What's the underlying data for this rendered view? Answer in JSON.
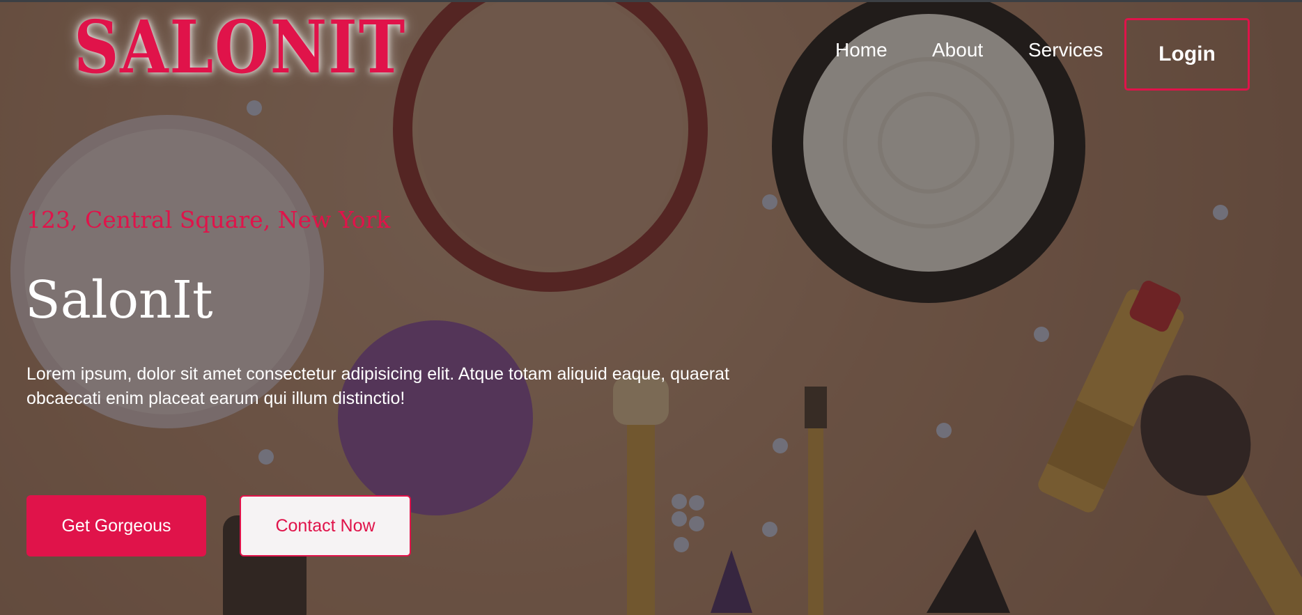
{
  "header": {
    "logo_text": "SALONIT",
    "nav": {
      "home": "Home",
      "about": "About",
      "services": "Services"
    },
    "login_label": "Login"
  },
  "hero": {
    "address": "123, Central Square, New York",
    "title": "SalonIt",
    "description": "Lorem ipsum, dolor sit amet consectetur adipisicing elit. Atque totam aliquid eaque, quaerat obcaecati enim placeat earum qui illum distinctio!",
    "primary_button": "Get Gorgeous",
    "secondary_button": "Contact Now"
  },
  "colors": {
    "accent": "#e0134a",
    "overlay": "#28201e",
    "text": "#ffffff"
  }
}
